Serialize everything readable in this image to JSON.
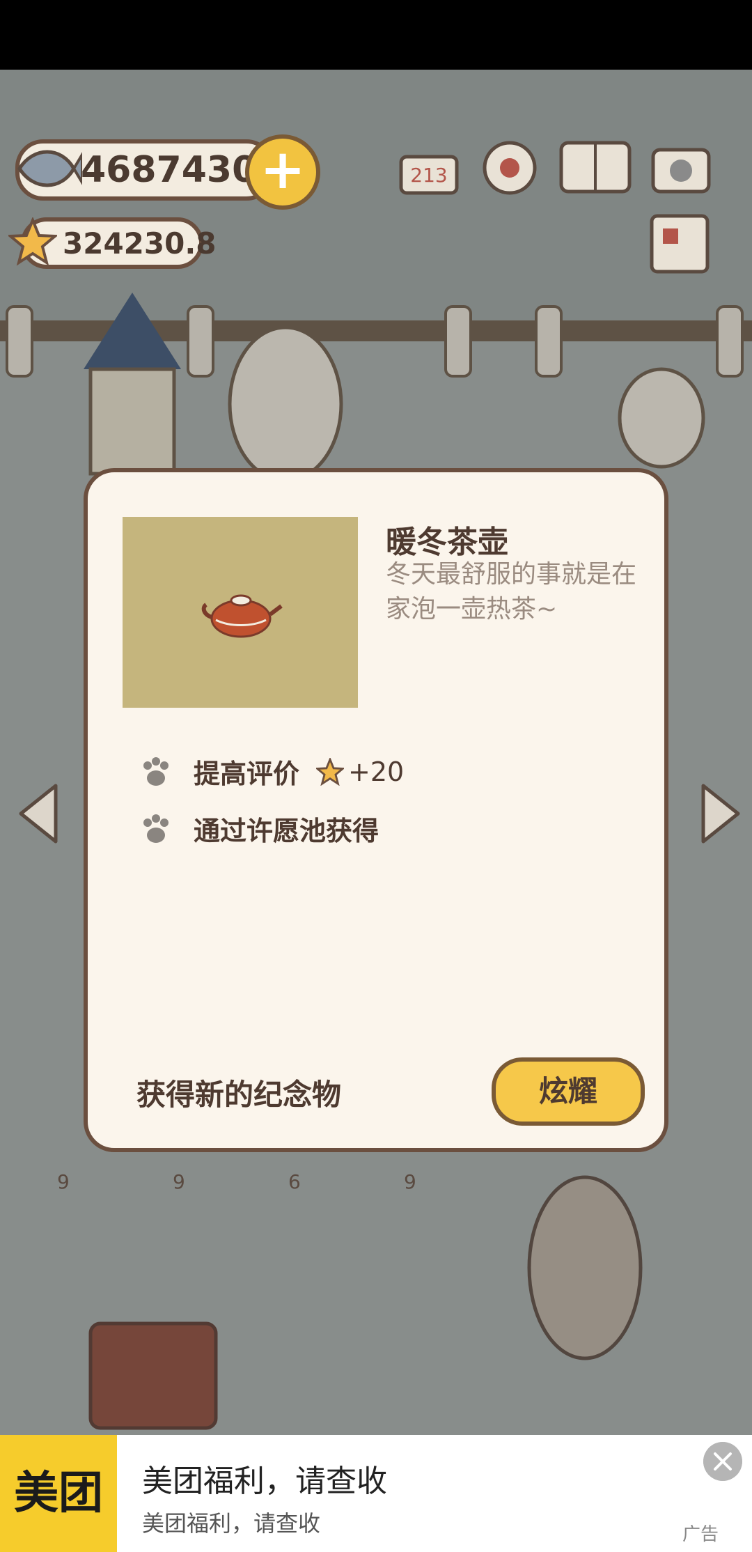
{
  "currency": {
    "fish_amount": "4687430",
    "star_amount": "324230.8"
  },
  "toolbar": {
    "icons": [
      "ranking-icon",
      "settings-icon",
      "album-icon",
      "camera-icon",
      "newspaper-icon"
    ]
  },
  "modal": {
    "item_title": "暖冬茶壶",
    "item_description": "冬天最舒服的事就是在家泡一壶热茶~",
    "features": [
      {
        "label": "提高评价",
        "bonus": "+20"
      },
      {
        "label": "通过许愿池获得"
      }
    ],
    "footer_text": "获得新的纪念物",
    "show_button_label": "炫耀"
  },
  "inventory_counts": [
    "9",
    "9",
    "6",
    "9"
  ],
  "ad": {
    "logo_text": "美团",
    "title": "美团福利，请查收",
    "subtitle": "美团福利，请查收",
    "ad_label": "广告"
  },
  "colors": {
    "accent_yellow": "#f6c84a",
    "border_brown": "#6b4f3f",
    "modal_bg": "#fbf5ec",
    "meituan_yellow": "#f6cc2c"
  }
}
